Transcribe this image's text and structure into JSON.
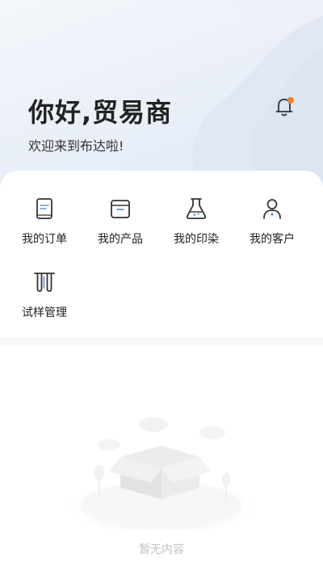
{
  "header": {
    "greeting": "你好,贸易商",
    "welcome": "欢迎来到布达啦!"
  },
  "menu": {
    "items": [
      {
        "label": "我的订单",
        "icon": "order-icon"
      },
      {
        "label": "我的产品",
        "icon": "product-box-icon"
      },
      {
        "label": "我的印染",
        "icon": "flask-icon"
      },
      {
        "label": "我的客户",
        "icon": "customer-icon"
      },
      {
        "label": "试样管理",
        "icon": "test-tube-icon"
      }
    ]
  },
  "empty_state": {
    "text": "暂无内容",
    "icon": "empty-box-icon"
  },
  "colors": {
    "accent": "#f5822a",
    "icon_stroke": "#333333",
    "icon_accent": "#6b8fd6"
  }
}
